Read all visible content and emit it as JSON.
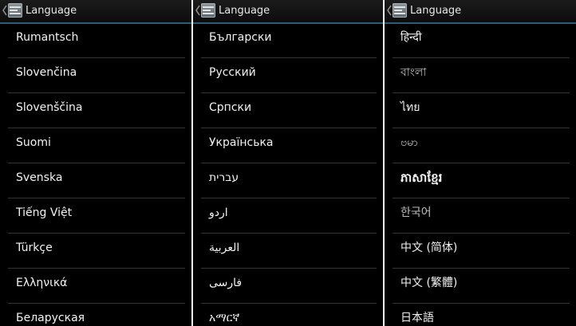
{
  "screens": [
    {
      "title": "Language",
      "languages": [
        "Rumantsch",
        "Slovenčina",
        "Slovenščina",
        "Suomi",
        "Svenska",
        "Tiếng Việt",
        "Türkçe",
        "Ελληνικά",
        "Беларуская"
      ]
    },
    {
      "title": "Language",
      "languages": [
        "Български",
        "Русский",
        "Српски",
        "Українська",
        "עברית",
        "اردو",
        "العربية",
        "فارسی",
        "አማርኛ"
      ]
    },
    {
      "title": "Language",
      "languages": [
        "हिन्दी",
        "বাংলা",
        "ไทย",
        "ဗမာ",
        "ភាសាខ្មែរ",
        "한국어",
        "中文 (简体)",
        "中文 (繁體)",
        "日本語"
      ]
    }
  ],
  "colors": {
    "background": "#000000",
    "text": "#f2f2f2",
    "divider": "#343434",
    "actionbar_accent": "#2a5c74"
  },
  "icons": [
    "back-caret-icon",
    "settings-app-icon"
  ]
}
